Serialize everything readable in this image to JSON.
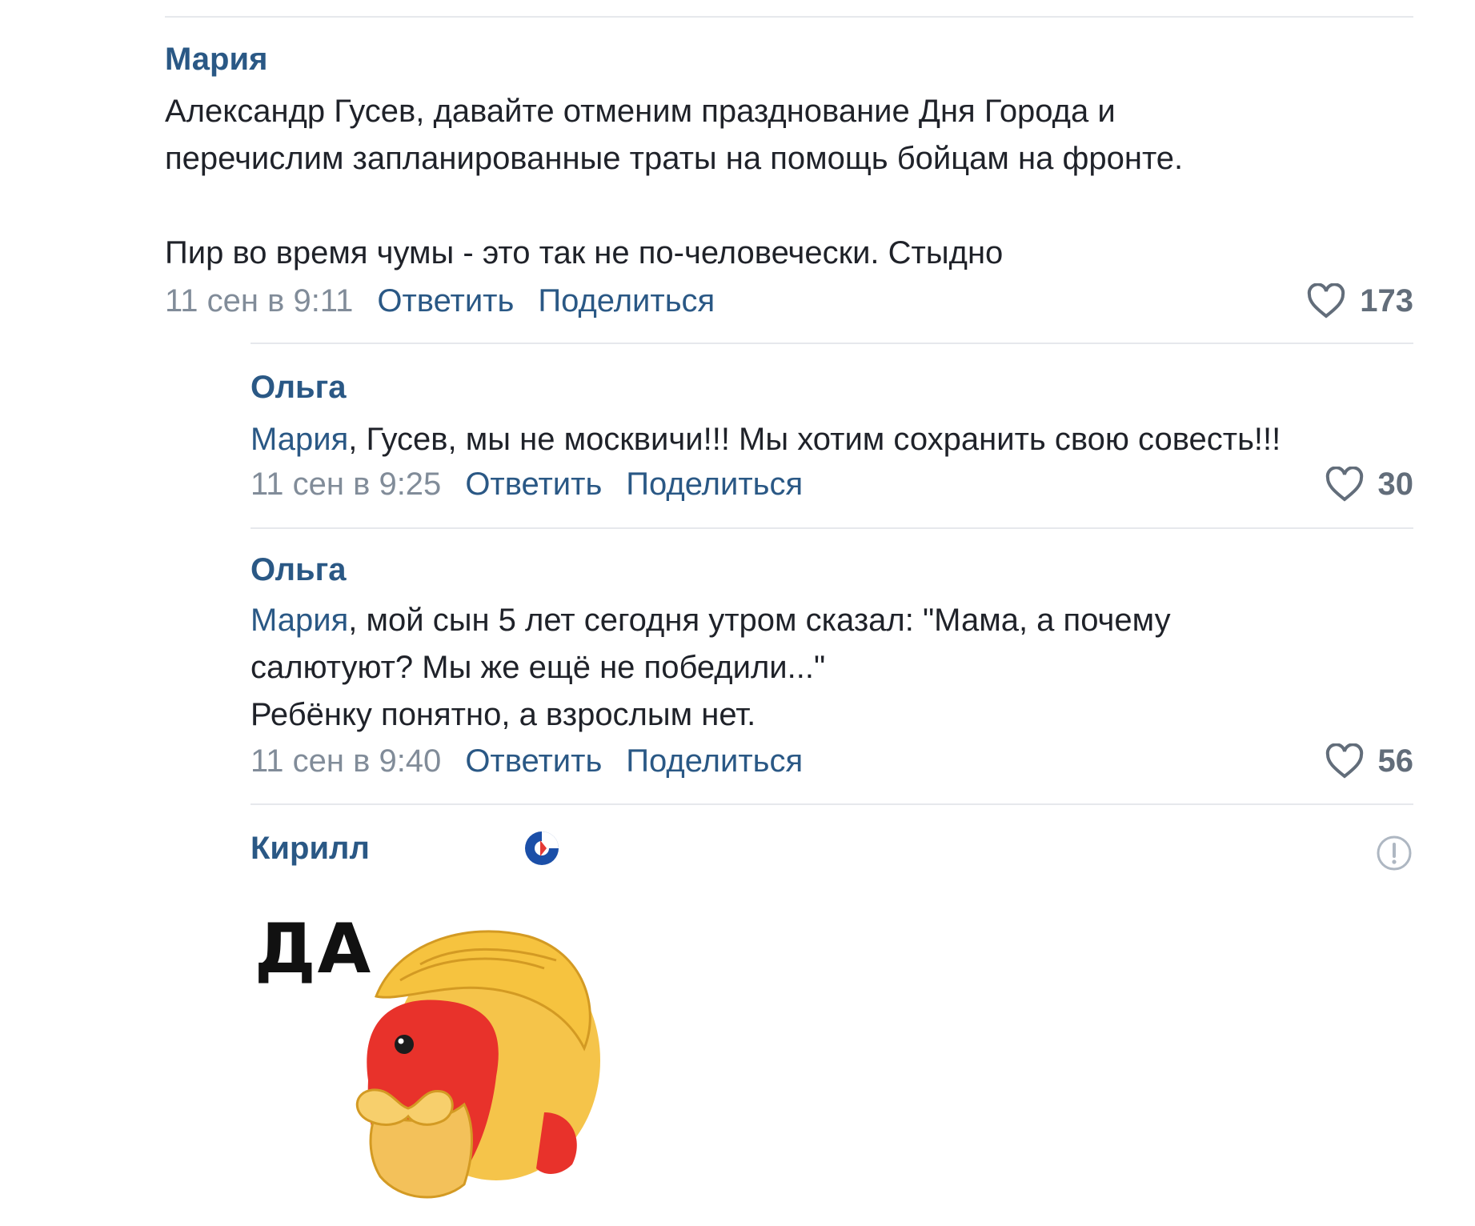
{
  "colors": {
    "author": "#2a5885",
    "text": "#1f2229",
    "meta": "#818c99",
    "divider": "#e6e8ec"
  },
  "comments": [
    {
      "author": "Мария",
      "lines": [
        "Александр Гусев, давайте отменим празднование Дня Города и",
        "перечислим запланированные траты на помощь бойцам на фронте."
      ],
      "line2": "Пир во время чумы - это так не по-человечески. Стыдно",
      "date": "11 сен в 9:11",
      "reply": "Ответить",
      "share": "Поделиться",
      "likes": "173"
    },
    {
      "author": "Ольга",
      "mention": "Мария",
      "text": ", Гусев, мы не москвичи!!! Мы хотим сохранить свою совесть!!!",
      "date": "11 сен в 9:25",
      "reply": "Ответить",
      "share": "Поделиться",
      "likes": "30"
    },
    {
      "author": "Ольга",
      "mention": "Мария",
      "text_line1": ", мой сын 5 лет сегодня утром сказал: \"Мама, а почему",
      "text_line2": "салютуют? Мы же ещё не победили...\"",
      "text_line3": "Ребёнку понятно, а взрослым нет.",
      "date": "11 сен в 9:40",
      "reply": "Ответить",
      "share": "Поделиться",
      "likes": "56"
    },
    {
      "author": "Кирилл",
      "sticker_text": "ДА",
      "badge_icon": "badge-icon",
      "report_icon": "info-circle-icon"
    }
  ]
}
